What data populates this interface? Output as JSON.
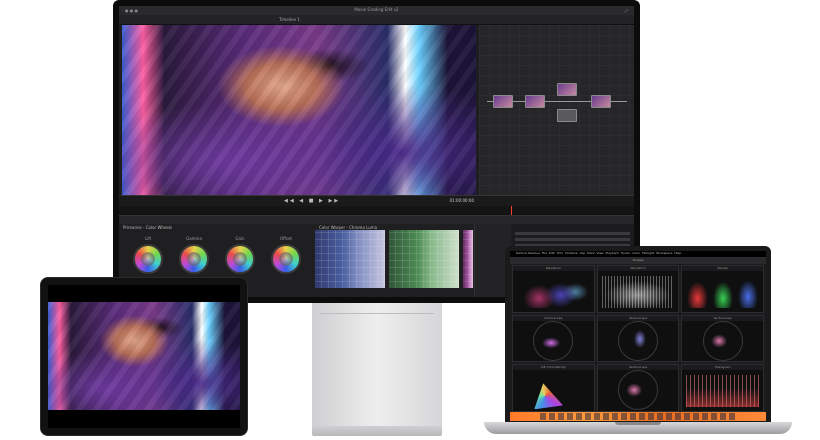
{
  "monitor": {
    "window_title": "Movie Grading Edit v2",
    "timeline_name": "Timeline 1",
    "timecode": "01:00:00:00",
    "primaries_label": "Primaries - Color Wheels",
    "wheels": [
      {
        "label": "Lift"
      },
      {
        "label": "Gamma"
      },
      {
        "label": "Gain"
      },
      {
        "label": "Offset"
      }
    ],
    "curves_label": "Color Warper - Chroma Luma"
  },
  "laptop": {
    "app_menu": [
      "DaVinci Resolve",
      "File",
      "Edit",
      "Trim",
      "Timeline",
      "Clip",
      "Mark",
      "View",
      "Playback",
      "Fusion",
      "Color",
      "Fairlight",
      "Workspace",
      "Help"
    ],
    "window_title": "Scopes",
    "scopes": [
      {
        "label": "Waveform"
      },
      {
        "label": "Waveform"
      },
      {
        "label": "Parade"
      },
      {
        "label": "Vectorscope"
      },
      {
        "label": "Vectorscope"
      },
      {
        "label": "Vectorscope"
      },
      {
        "label": "CIE Chromaticity"
      },
      {
        "label": "Vectorscope"
      },
      {
        "label": "Histogram"
      }
    ]
  },
  "colors": {
    "dock_accent": "#ff7a2a",
    "playhead": "#ff3b2f"
  }
}
